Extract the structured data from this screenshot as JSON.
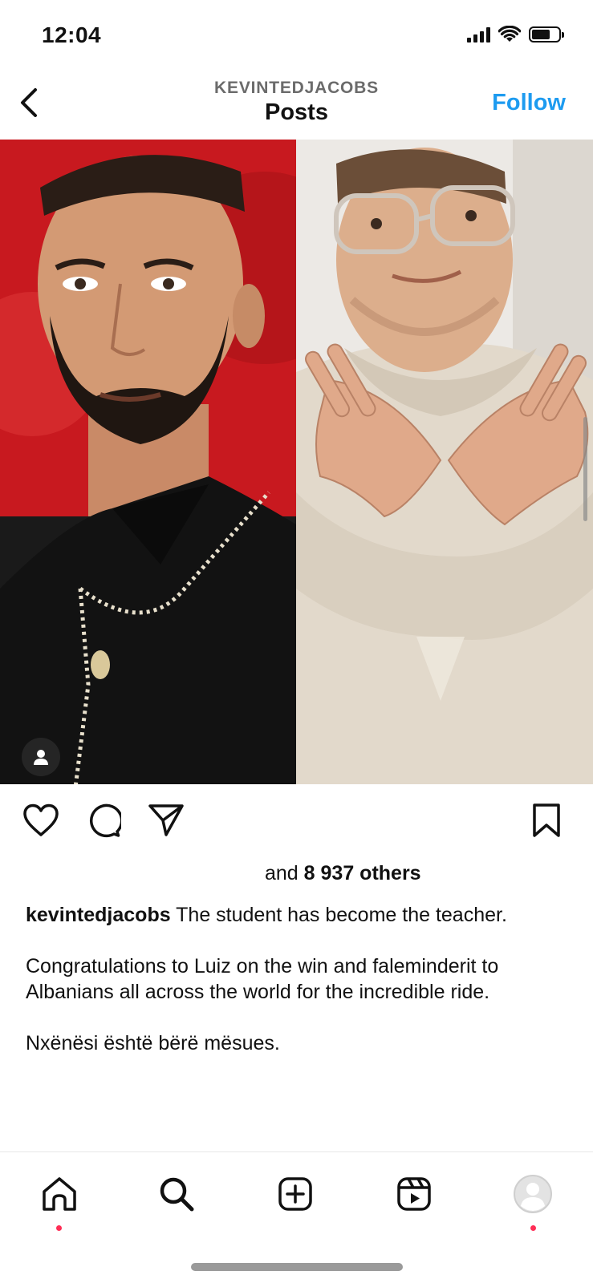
{
  "status_bar": {
    "time": "12:04"
  },
  "header": {
    "username": "KEVINTEDJACOBS",
    "title": "Posts",
    "follow_label": "Follow"
  },
  "post": {
    "likes_prefix": "and",
    "likes_count": "8 937 others",
    "caption_user": "kevintedjacobs",
    "caption_lines": [
      "The student has become the teacher.",
      "Congratulations to Luiz on the win and faleminderit to Albanians all across the world for the incredible ride.",
      "Nxënësi është bërë mësues."
    ]
  },
  "colors": {
    "accent": "#1d9bf0",
    "notification_dot": "#ff2d55"
  },
  "icons": {
    "back": "chevron-left-icon",
    "like": "heart-icon",
    "comment": "comment-icon",
    "share": "paper-plane-icon",
    "save": "bookmark-icon",
    "tag": "person-icon",
    "nav": [
      "home-icon",
      "search-icon",
      "add-post-icon",
      "reels-icon",
      "profile-avatar-icon"
    ]
  }
}
